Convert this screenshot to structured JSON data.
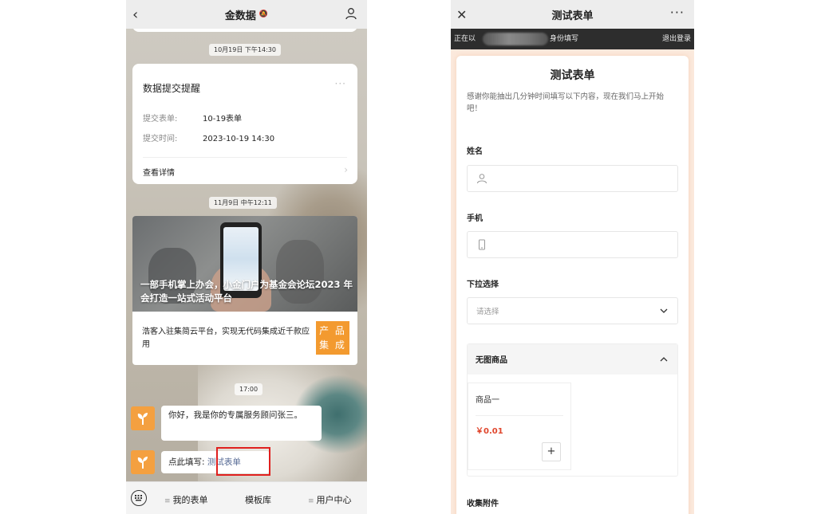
{
  "left_phone": {
    "nav": {
      "title": "金数据",
      "mute_glyph": "🔕"
    },
    "time1": "10月19日 下午14:30",
    "reminder": {
      "title": "数据提交提醒",
      "more": "···",
      "rows": [
        {
          "key": "提交表单:",
          "value": "10-19表单"
        },
        {
          "key": "提交时间:",
          "value": "2023-10-19 14:30"
        }
      ],
      "detail": "查看详情"
    },
    "time2": "11月9日 中午12:11",
    "article": {
      "headline": "一部手机掌上办会，小金门户为基金会论坛2023 年会打造一站式活动平台",
      "sub": "浩客入驻集简云平台，实现无代码集成近千款应用",
      "badge_top": "产 品",
      "badge_bottom": "集 成"
    },
    "time3": "17:00",
    "messages": [
      {
        "text": "你好，我是你的专属服务顾问张三。"
      },
      {
        "prefix": "点此填写:",
        "link": "测试表单"
      }
    ],
    "tabbar": [
      {
        "marker": "≡",
        "label": "我的表单"
      },
      {
        "marker": "",
        "label": "模板库"
      },
      {
        "marker": "≡",
        "label": "用户中心"
      }
    ]
  },
  "right_phone": {
    "nav": {
      "title": "测试表单",
      "close": "✕",
      "more": "···"
    },
    "status_bar": {
      "prefix": "正在以",
      "suffix": "身份填写",
      "logout": "退出登录"
    },
    "form": {
      "title": "测试表单",
      "intro": "感谢你能抽出几分钟时间填写以下内容，现在我们马上开始吧！",
      "fields": [
        {
          "label": "姓名",
          "type": "text",
          "icon": "user-icon"
        },
        {
          "label": "手机",
          "type": "phone",
          "icon": "phone-icon"
        },
        {
          "label": "下拉选择",
          "type": "select",
          "placeholder": "请选择"
        }
      ],
      "group": {
        "title": "无图商品",
        "product": {
          "name": "商品一",
          "price": "￥0.01",
          "add": "+"
        }
      },
      "attach_label": "收集附件"
    }
  },
  "colors": {
    "accent_orange": "#f39a2f",
    "link_blue": "#576b95",
    "price_red": "#e0462c",
    "highlight_red": "#e0201e",
    "form_bg": "#fbe9dc"
  }
}
